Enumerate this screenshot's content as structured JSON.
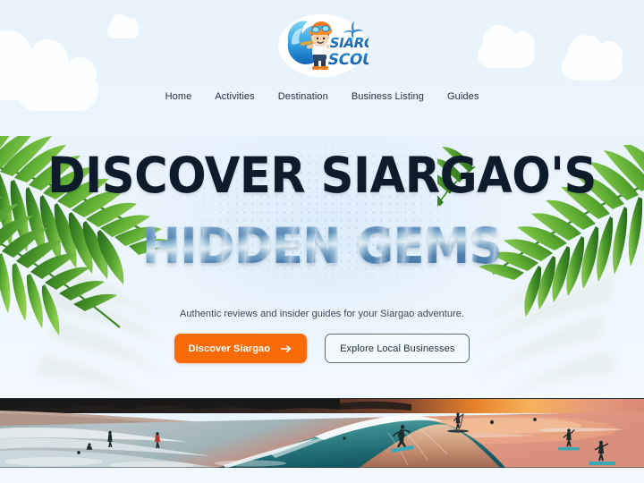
{
  "site": {
    "logo": {
      "name": "siargao-scout-logo",
      "line1": "SIARGAO",
      "line2": "SCOUT"
    }
  },
  "nav": {
    "items": [
      {
        "label": "Home"
      },
      {
        "label": "Activities"
      },
      {
        "label": "Destination"
      },
      {
        "label": "Business Listing"
      },
      {
        "label": "Guides"
      }
    ]
  },
  "hero": {
    "headline_line1": "DISCOVER SIARGAO'S",
    "headline_line2": "HIDDEN GEMS",
    "subtitle": "Authentic reviews and insider guides for your Siargao adventure.",
    "primary_cta": {
      "label": "Discover Siargao",
      "icon": "arrow-right-icon",
      "color": "#f96a09"
    },
    "secondary_cta": {
      "label": "Explore Local Businesses"
    },
    "decor": {
      "palm_left": "palm-frond-left",
      "palm_right": "palm-frond-right",
      "clouds": [
        "cloud-large-left",
        "cloud-small-left",
        "cloud-right-1",
        "cloud-right-2"
      ]
    }
  },
  "banner": {
    "image": "sunset-surf-photo",
    "alt": "Surfers riding a wave at sunset in Siargao"
  },
  "colors": {
    "background": "#e9f3fc",
    "headline": "#0d1b2a",
    "accent_orange": "#f96a09",
    "nav_text": "#26323c",
    "gem_blue": "#5b8cb8"
  }
}
